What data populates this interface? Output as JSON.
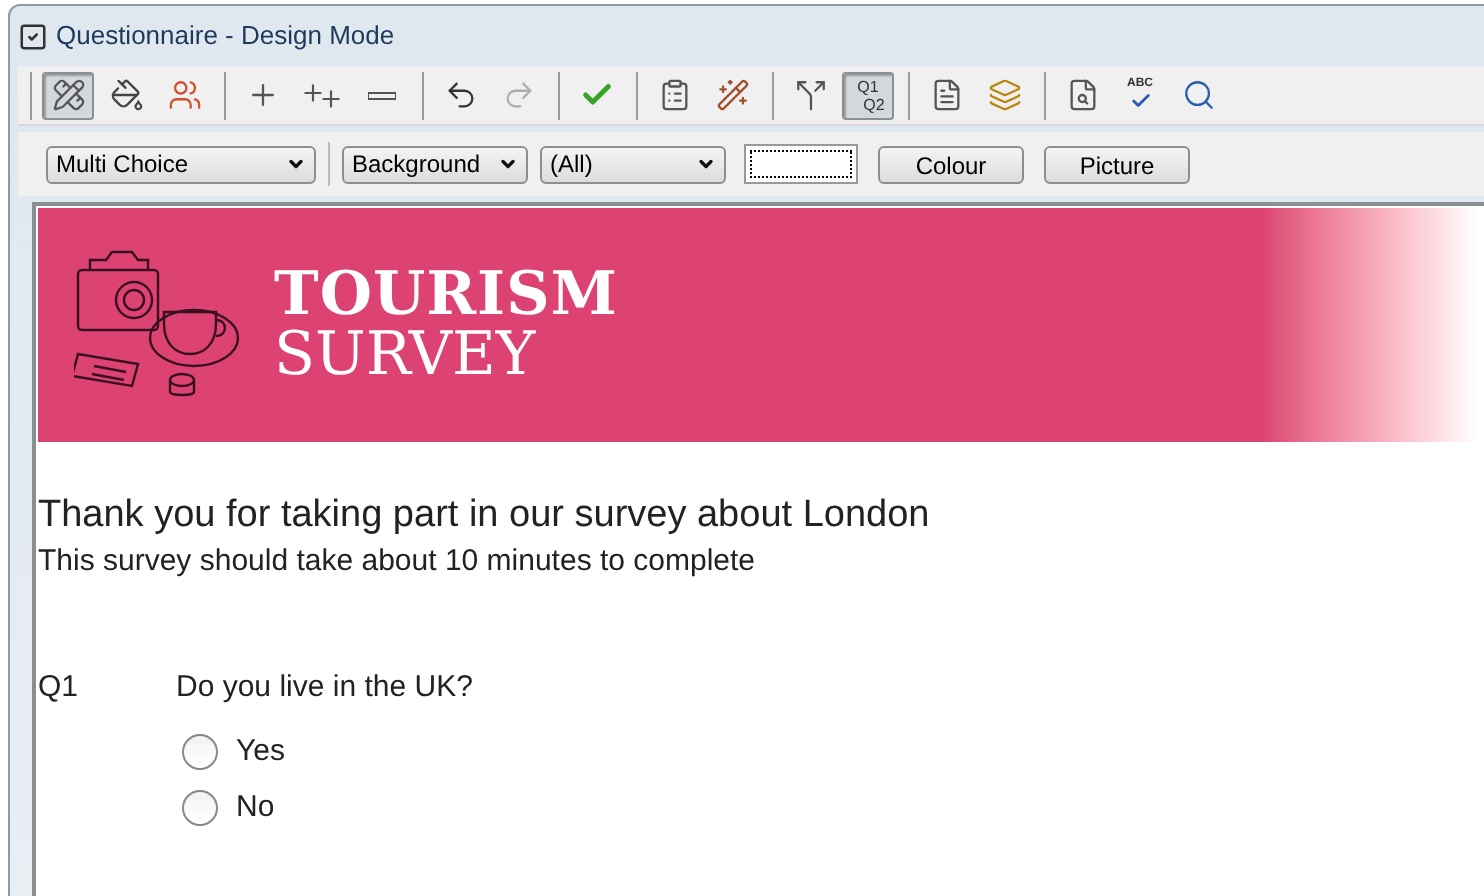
{
  "window": {
    "title": "Questionnaire - Design Mode"
  },
  "toolbar": [
    [
      {
        "kind": "design",
        "selected": true,
        "disabled": false
      },
      {
        "kind": "format",
        "selected": false,
        "disabled": false
      },
      {
        "kind": "users",
        "selected": false,
        "disabled": false
      }
    ],
    [
      {
        "kind": "add",
        "selected": false,
        "disabled": false
      },
      {
        "kind": "add-multiple",
        "selected": false,
        "disabled": false
      },
      {
        "kind": "remove",
        "selected": false,
        "disabled": false
      }
    ],
    [
      {
        "kind": "undo",
        "selected": false,
        "disabled": false
      },
      {
        "kind": "redo",
        "selected": false,
        "disabled": true
      }
    ],
    [
      {
        "kind": "check",
        "selected": false,
        "disabled": false
      }
    ],
    [
      {
        "kind": "properties",
        "selected": false,
        "disabled": false
      },
      {
        "kind": "wizard",
        "selected": false,
        "disabled": false
      }
    ],
    [
      {
        "kind": "route",
        "selected": false,
        "disabled": false
      },
      {
        "kind": "numbering",
        "selected": true,
        "disabled": false,
        "label_lines": [
          "Q1",
          "Q2"
        ]
      }
    ],
    [
      {
        "kind": "page",
        "selected": false,
        "disabled": false
      },
      {
        "kind": "layers",
        "selected": false,
        "disabled": false
      }
    ],
    [
      {
        "kind": "preview",
        "selected": false,
        "disabled": false
      },
      {
        "kind": "spelling",
        "selected": false,
        "disabled": false,
        "label": "ABC"
      },
      {
        "kind": "zoom",
        "selected": false,
        "disabled": false
      }
    ]
  ],
  "format_bar": {
    "question_type": "Multi Choice",
    "element": "Background",
    "scope": "(All)",
    "buttons": [
      "Colour",
      "Picture"
    ]
  },
  "banner": {
    "title": "TOURISM",
    "subtitle": "SURVEY"
  },
  "intro": {
    "heading": "Thank you for taking part in our survey about London",
    "text": "This survey should take about 10 minutes to complete"
  },
  "questions": [
    {
      "number": "Q1",
      "text": "Do you live in the UK?",
      "options": [
        {
          "label": "Yes",
          "selected": false
        },
        {
          "label": "No",
          "selected": false
        }
      ]
    }
  ]
}
